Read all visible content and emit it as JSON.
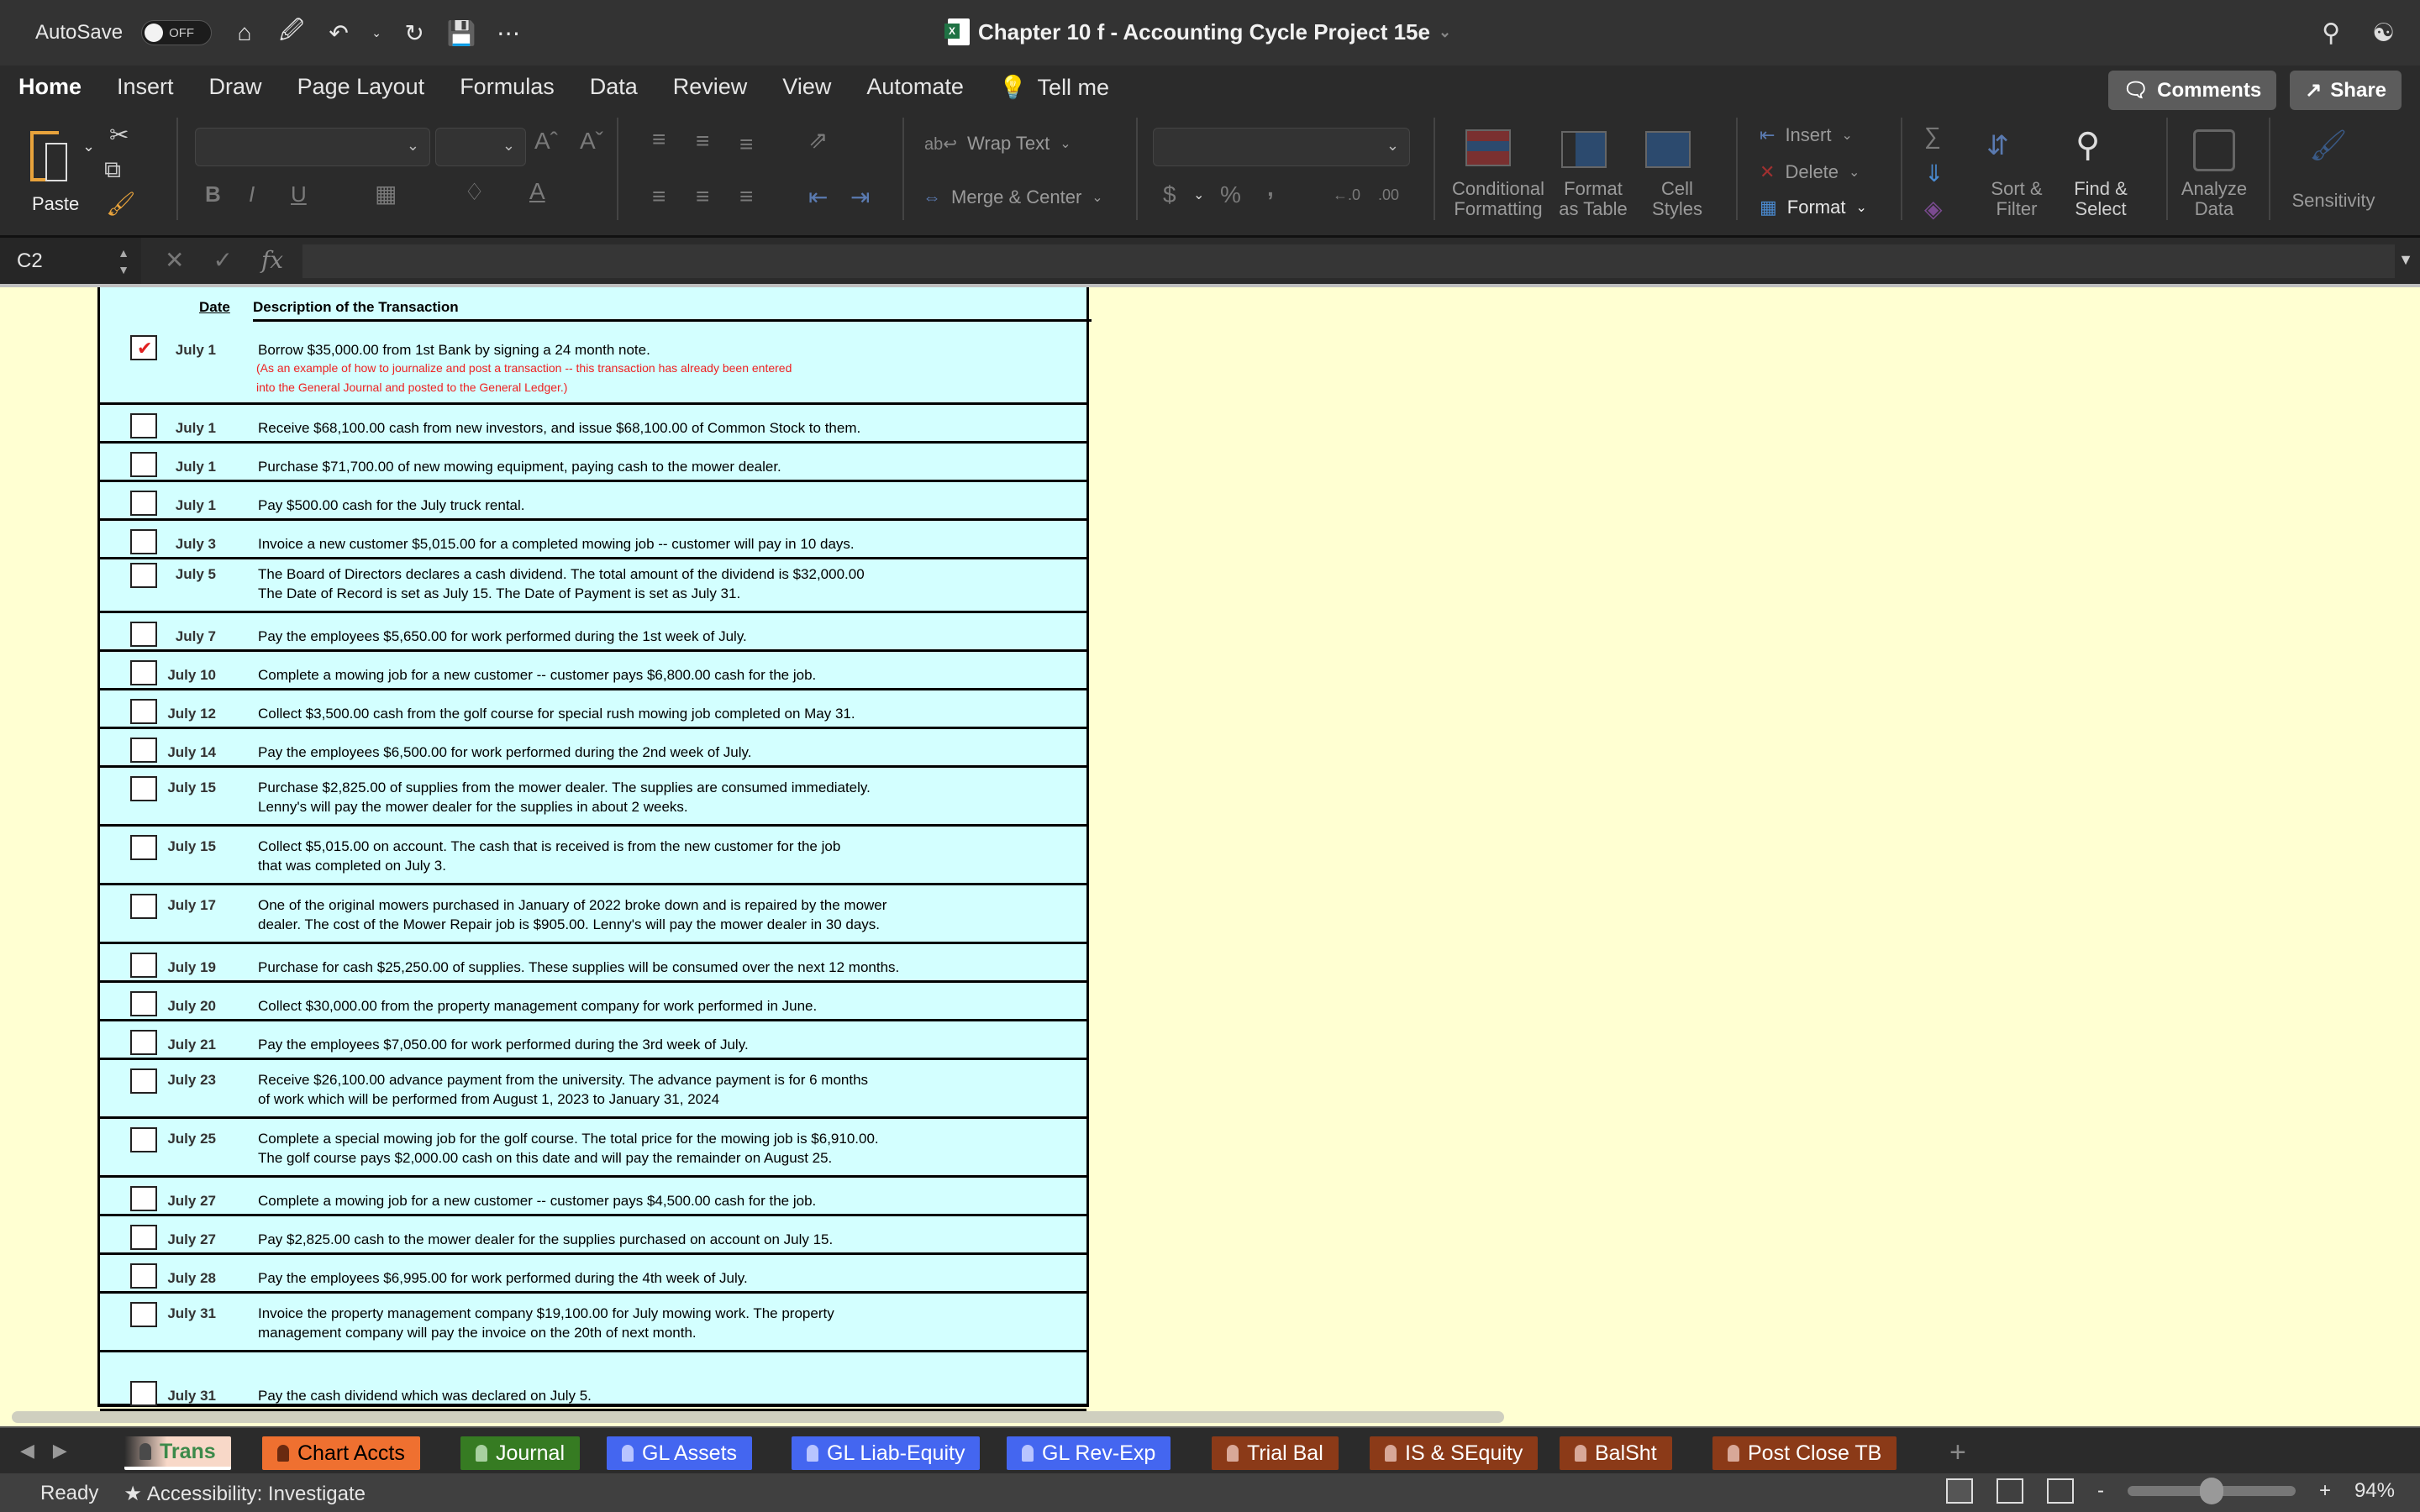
{
  "titlebar": {
    "autosave_label": "AutoSave",
    "autosave_state": "OFF",
    "quick_access": [
      "home-icon",
      "save-as-icon",
      "undo-icon",
      "redo-icon",
      "save-icon",
      "more-icon"
    ],
    "document_title": "Chapter 10 f - Accounting Cycle Project 15e",
    "right_icons": [
      "search-icon",
      "share-people-icon"
    ]
  },
  "menu": {
    "tabs": [
      "Home",
      "Insert",
      "Draw",
      "Page Layout",
      "Formulas",
      "Data",
      "Review",
      "View",
      "Automate"
    ],
    "active_tab": "Home",
    "tell_me": "Tell me",
    "comments_label": "Comments",
    "share_label": "Share"
  },
  "ribbon": {
    "paste": "Paste",
    "wrap_text": "Wrap Text",
    "merge_center": "Merge & Center",
    "conditional_formatting": [
      "Conditional",
      "Formatting"
    ],
    "format_as_table": [
      "Format",
      "as Table"
    ],
    "cell_styles": [
      "Cell",
      "Styles"
    ],
    "insert": "Insert",
    "delete": "Delete",
    "format": "Format",
    "sort_filter": [
      "Sort &",
      "Filter"
    ],
    "find_select": [
      "Find &",
      "Select"
    ],
    "analyze_data": [
      "Analyze",
      "Data"
    ],
    "sensitivity": "Sensitivity",
    "bold": "B",
    "italic": "I",
    "underline": "U",
    "percent": "%",
    "dollar": "$",
    "comma": ","
  },
  "formula_bar": {
    "name_box": "C2",
    "formula_value": ""
  },
  "sheet": {
    "header_date": "Date",
    "header_description": "Description of the Transaction",
    "transactions": [
      {
        "checked": true,
        "date": "July 1",
        "lines": [
          "Borrow $35,000.00 from 1st Bank by signing a 24 month note."
        ],
        "note": [
          "(As an example of how to journalize and post a transaction -- this transaction has already been entered",
          " into the General Journal and posted to the General Ledger.)"
        ]
      },
      {
        "checked": false,
        "date": "July 1",
        "lines": [
          "Receive $68,100.00 cash from new investors, and issue $68,100.00 of Common Stock to them."
        ]
      },
      {
        "checked": false,
        "date": "July 1",
        "lines": [
          "Purchase $71,700.00 of new mowing equipment, paying cash to the mower dealer."
        ]
      },
      {
        "checked": false,
        "date": "July 1",
        "lines": [
          "Pay $500.00 cash for the July truck rental."
        ]
      },
      {
        "checked": false,
        "date": "July 3",
        "lines": [
          "Invoice a new customer $5,015.00 for a completed mowing job -- customer will pay in 10 days."
        ]
      },
      {
        "checked": false,
        "date": "July 5",
        "lines": [
          "The Board of Directors declares a cash dividend.  The total amount of the dividend is $32,000.00",
          "The Date of Record is set as July 15.  The Date of Payment is set as July 31."
        ]
      },
      {
        "checked": false,
        "date": "July 7",
        "lines": [
          "Pay the employees $5,650.00 for work performed during the 1st week of July."
        ]
      },
      {
        "checked": false,
        "date": "July 10",
        "lines": [
          "Complete a mowing job for a new customer -- customer pays $6,800.00 cash for the job."
        ]
      },
      {
        "checked": false,
        "date": "July 12",
        "lines": [
          "Collect $3,500.00 cash from the golf course for special rush mowing job completed on May 31."
        ]
      },
      {
        "checked": false,
        "date": "July 14",
        "lines": [
          "Pay the employees $6,500.00 for work performed during the 2nd week of July."
        ]
      },
      {
        "checked": false,
        "date": "July 15",
        "lines": [
          "Purchase $2,825.00 of supplies from the mower dealer.  The supplies are consumed immediately.",
          "Lenny's will pay the mower dealer for the supplies in about 2 weeks."
        ]
      },
      {
        "checked": false,
        "date": "July 15",
        "lines": [
          "Collect $5,015.00 on account.  The cash that is received is from the new customer for the job",
          "that was completed on July 3."
        ]
      },
      {
        "checked": false,
        "date": "July 17",
        "lines": [
          "One of the original mowers purchased in January of 2022 broke down and is repaired by the mower",
          "dealer.  The cost of the Mower Repair job is $905.00.  Lenny's will pay the mower dealer in 30 days."
        ]
      },
      {
        "checked": false,
        "date": "July 19",
        "lines": [
          "Purchase for cash $25,250.00 of supplies.  These supplies will be consumed over the next 12 months."
        ]
      },
      {
        "checked": false,
        "date": "July 20",
        "lines": [
          "Collect $30,000.00 from the property management company for work performed in June."
        ]
      },
      {
        "checked": false,
        "date": "July 21",
        "lines": [
          "Pay the employees $7,050.00 for work performed during the 3rd week of July."
        ]
      },
      {
        "checked": false,
        "date": "July 23",
        "lines": [
          "Receive $26,100.00 advance payment from the university.  The advance payment is for 6 months",
          "of work which will be performed from August 1, 2023 to January 31, 2024"
        ]
      },
      {
        "checked": false,
        "date": "July 25",
        "lines": [
          "Complete a special mowing job for the golf course.  The total price for the mowing job is $6,910.00.",
          "The golf course pays $2,000.00 cash on this date and will pay the remainder on August 25."
        ]
      },
      {
        "checked": false,
        "date": "July 27",
        "lines": [
          "Complete a mowing job for a new customer -- customer pays $4,500.00 cash for the job."
        ]
      },
      {
        "checked": false,
        "date": "July 27",
        "lines": [
          "Pay $2,825.00 cash to the mower dealer for the supplies purchased on account on July 15."
        ]
      },
      {
        "checked": false,
        "date": "July 28",
        "lines": [
          "Pay the employees $6,995.00 for work performed during the 4th week of July."
        ]
      },
      {
        "checked": false,
        "date": "July 31",
        "lines": [
          "Invoice the property management company $19,100.00 for July mowing work.  The property",
          "management company will pay the invoice on the 20th of next month."
        ]
      },
      {
        "checked": false,
        "date": "July 31",
        "lines": [
          "Pay the cash dividend which was declared on July 5."
        ]
      }
    ]
  },
  "sheet_tabs": [
    {
      "label": "Trans",
      "active": true,
      "bg": "#f8d8c8",
      "fg": "#3c8a4a",
      "lock": "#4a4a4a"
    },
    {
      "label": "Chart Accts",
      "active": false,
      "bg": "#ef7030",
      "fg": "#000000",
      "lock": "#6a2a10"
    },
    {
      "label": "Journal",
      "active": false,
      "bg": "#367b22",
      "fg": "#ffffff",
      "lock": "#a8d0a0"
    },
    {
      "label": "GL Assets",
      "active": false,
      "bg": "#4466f0",
      "fg": "#ffffff",
      "lock": "#b8c4ff"
    },
    {
      "label": "GL Liab-Equity",
      "active": false,
      "bg": "#4466f0",
      "fg": "#ffffff",
      "lock": "#b8c4ff"
    },
    {
      "label": "GL Rev-Exp",
      "active": false,
      "bg": "#4466f0",
      "fg": "#ffffff",
      "lock": "#b8c4ff"
    },
    {
      "label": "Trial Bal",
      "active": false,
      "bg": "#8b3a18",
      "fg": "#ffffff",
      "lock": "#d8a898"
    },
    {
      "label": "IS & SEquity",
      "active": false,
      "bg": "#8b3a18",
      "fg": "#ffffff",
      "lock": "#d8a898"
    },
    {
      "label": "BalSht",
      "active": false,
      "bg": "#8b3a18",
      "fg": "#ffffff",
      "lock": "#d8a898"
    },
    {
      "label": "Post Close TB",
      "active": false,
      "bg": "#8b3a18",
      "fg": "#ffffff",
      "lock": "#d8a898"
    }
  ],
  "statusbar": {
    "ready": "Ready",
    "accessibility": "Accessibility: Investigate",
    "zoom": "94%",
    "zoom_minus": "-",
    "zoom_plus": "+"
  }
}
